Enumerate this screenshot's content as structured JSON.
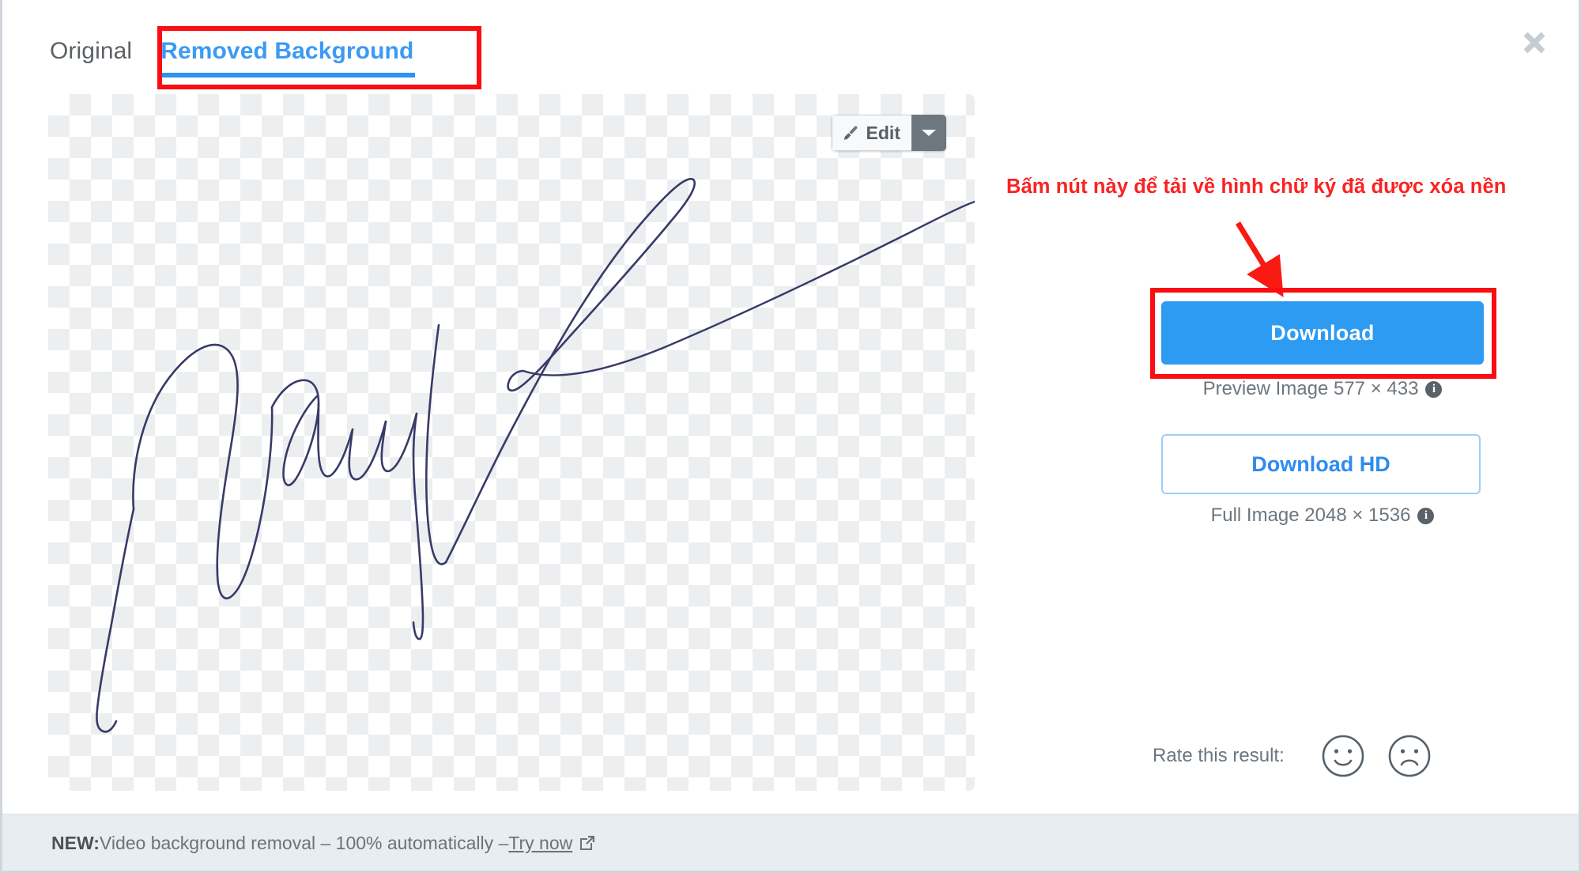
{
  "window": {
    "close_label": "close-icon"
  },
  "tabs": [
    {
      "label": "Original",
      "active": false
    },
    {
      "label": "Removed Background",
      "active": true
    }
  ],
  "preview": {
    "edit_button_label": "Edit",
    "edit_icon": "paint-brush-icon",
    "caret_icon": "chevron-down-icon",
    "background": "transparent-checkerboard",
    "content": "handwritten-signature"
  },
  "annotation": {
    "text": "Bấm nút này để tải về hình chữ ký đã được xóa nền",
    "color": "#fb2222",
    "arrow": "red-arrow-pointing-to-download"
  },
  "download_panel": {
    "download_label": "Download",
    "preview_caption": "Preview Image 577 × 433",
    "download_hd_label": "Download HD",
    "full_caption": "Full Image 2048 × 1536",
    "info_glyph": "i",
    "accent_color": "#2e9bf2",
    "hd_border_color": "#9fcdf7"
  },
  "rating": {
    "label": "Rate this result:",
    "positive_icon": "smiley-happy-icon",
    "negative_icon": "smiley-sad-icon"
  },
  "bottom_banner": {
    "badge": "NEW:",
    "message": " Video background removal – 100% automatically – ",
    "link_label": "Try now",
    "link_icon": "external-link-icon"
  }
}
